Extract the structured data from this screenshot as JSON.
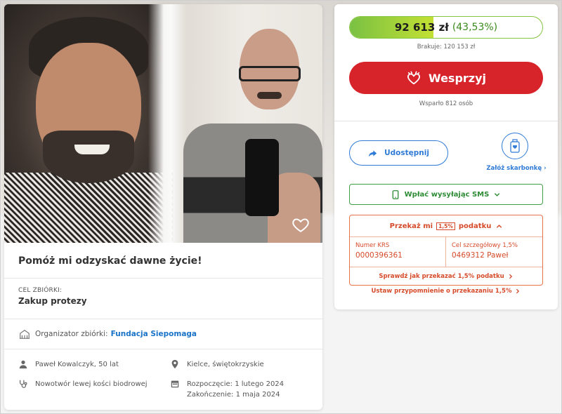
{
  "campaign": {
    "title": "Pomóż mi odzyskać dawne życie!",
    "goal_label": "CEL ZBIÓRKI:",
    "goal_value": "Zakup protezy",
    "organizer_label": "Organizator zbiórki:",
    "organizer_name": "Fundacja Siepomaga",
    "beneficiary": "Paweł Kowalczyk, 50 lat",
    "location": "Kielce, świętokrzyskie",
    "diagnosis": "Nowotwór lewej kości biodrowej",
    "start_date": "Rozpoczęcie: 1 lutego 2024",
    "end_date": "Zakończenie: 1 maja 2024"
  },
  "progress": {
    "amount": "92 613 zł",
    "percent_text": "(43,53%)",
    "fraction": 0.4353,
    "missing": "Brakuje: 120 153 zł",
    "supporters": "Wsparło 812 osób"
  },
  "actions": {
    "donate_label": "Wesprzyj",
    "share_label": "Udostępnij",
    "piggy_label": "Załóż skarbonkę",
    "sms_label": "Wpłać wysyłając SMS"
  },
  "tax": {
    "head_prefix": "Przekaż mi",
    "badge": "1,5%",
    "head_suffix": "podatku",
    "krs_label": "Numer KRS",
    "krs_value": "0000396361",
    "goal_label": "Cel szczegółowy 1,5%",
    "goal_value": "0469312 Paweł",
    "check_link": "Sprawdź jak przekazać 1,5% podatku",
    "reminder_link": "Ustaw przypomnienie o przekazaniu 1,5%"
  },
  "icons": {
    "heart": "heart-icon",
    "share": "share-arrow-icon",
    "piggy": "piggy-bank-icon",
    "phone": "phone-icon",
    "person": "person-icon",
    "location": "location-pin-icon",
    "stethoscope": "stethoscope-icon",
    "calendar": "calendar-icon",
    "organizer": "organizer-building-icon",
    "donate": "siepomaga-heart-logo-icon"
  },
  "colors": {
    "donate_red": "#d7242a",
    "progress_green": "#7ac143",
    "link_blue": "#2f7bd6",
    "tax_orange": "#d64a2a",
    "sms_green": "#3ea043"
  }
}
